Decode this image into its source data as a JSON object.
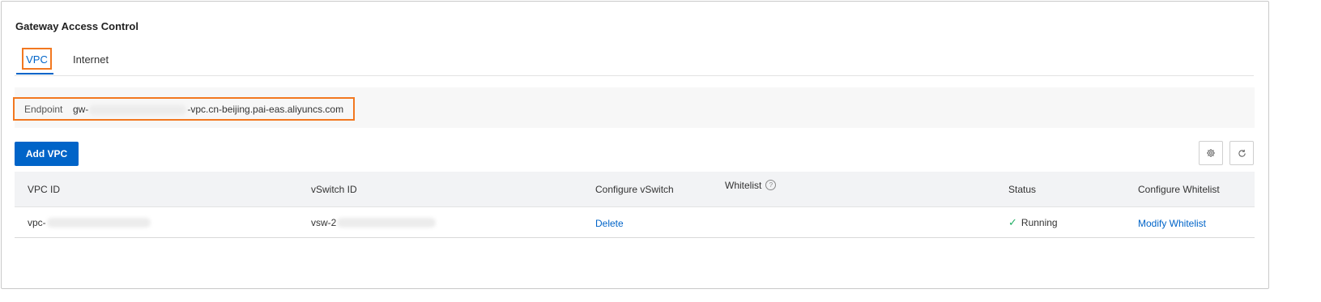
{
  "section": {
    "title": "Gateway Access Control"
  },
  "tabs": [
    {
      "label": "VPC",
      "active": true
    },
    {
      "label": "Internet",
      "active": false
    }
  ],
  "endpoint": {
    "label": "Endpoint",
    "value_prefix": "gw-",
    "value_suffix": "-vpc.cn-beijing.pai-eas.aliyuncs.com"
  },
  "toolbar": {
    "add_label": "Add VPC",
    "settings_icon": "gear-icon",
    "refresh_icon": "refresh-icon"
  },
  "table": {
    "columns": [
      "VPC ID",
      "vSwitch ID",
      "Configure vSwitch",
      "Whitelist",
      "Status",
      "Configure Whitelist"
    ],
    "rows": [
      {
        "vpc_id": "vpc-",
        "vswitch_id": "vsw-2",
        "configure_vswitch": "Delete",
        "whitelist": "",
        "status": "Running",
        "configure_whitelist": "Modify Whitelist"
      }
    ]
  },
  "colors": {
    "accent": "#0064c8",
    "highlight": "#f27820",
    "success": "#23b066"
  }
}
